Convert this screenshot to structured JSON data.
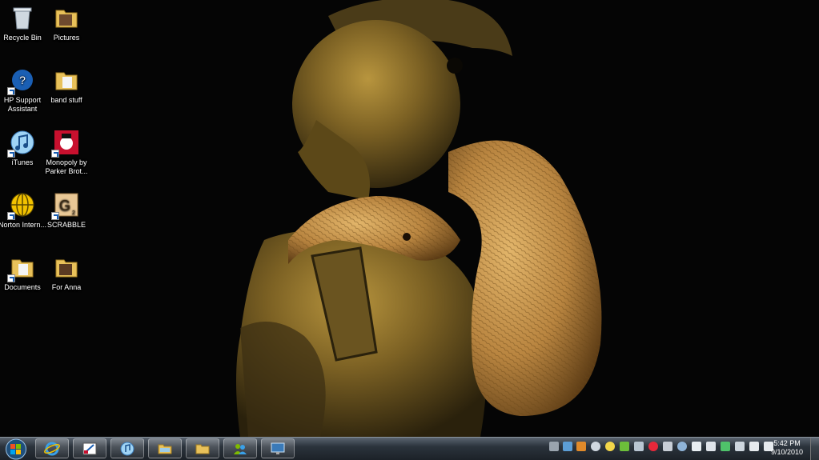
{
  "desktop": {
    "icons": [
      {
        "label": "Recycle Bin",
        "icon": "recycle-bin-icon"
      },
      {
        "label": "Pictures",
        "icon": "folder-icon"
      },
      {
        "label": "HP Support Assistant",
        "icon": "hp-support-icon"
      },
      {
        "label": "band stuff",
        "icon": "folder-icon"
      },
      {
        "label": "iTunes",
        "icon": "itunes-icon"
      },
      {
        "label": "Monopoly by Parker Brot...",
        "icon": "monopoly-icon"
      },
      {
        "label": "Norton Intern...",
        "icon": "norton-icon"
      },
      {
        "label": "SCRABBLE",
        "icon": "scrabble-icon"
      },
      {
        "label": "Documents",
        "icon": "folder-icon"
      },
      {
        "label": "For Anna",
        "icon": "folder-icon"
      }
    ]
  },
  "taskbar": {
    "pinned": [
      {
        "icon": "internet-explorer-icon"
      },
      {
        "icon": "paint-program-icon"
      },
      {
        "icon": "itunes-icon"
      },
      {
        "icon": "file-explorer-icon"
      },
      {
        "icon": "folder-icon"
      },
      {
        "icon": "users-icon"
      },
      {
        "icon": "remote-desktop-icon"
      }
    ],
    "clock": {
      "time": "5:42 PM",
      "date": "9/10/2010"
    }
  }
}
